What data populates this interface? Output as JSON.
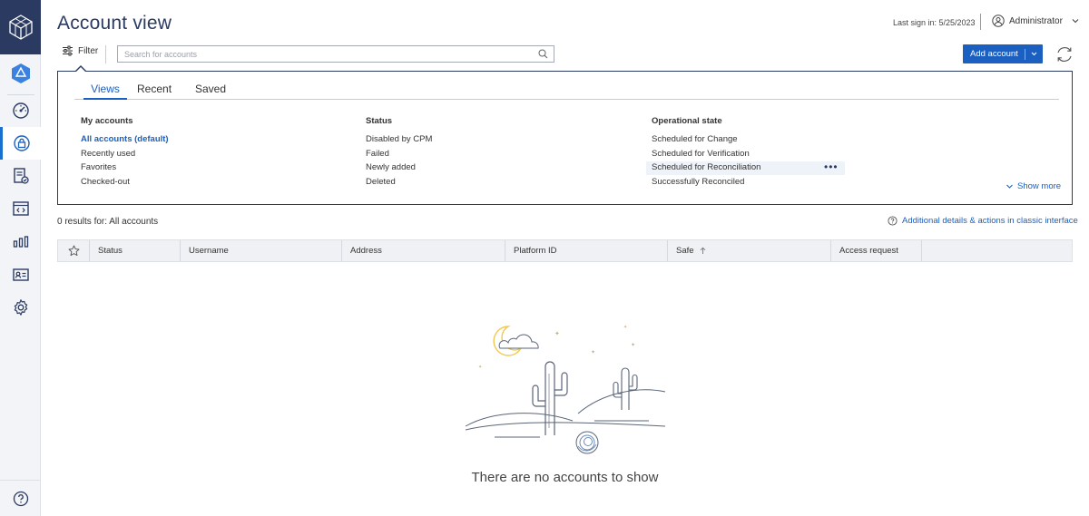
{
  "header": {
    "title": "Account view",
    "last_sign_in": "Last sign in: 5/25/2023",
    "user_name": "Administrator"
  },
  "toolbar": {
    "filter_label": "Filter",
    "search_placeholder": "Search for accounts",
    "add_account_label": "Add account"
  },
  "filter_panel": {
    "tabs": [
      {
        "label": "Views",
        "active": true
      },
      {
        "label": "Recent",
        "active": false
      },
      {
        "label": "Saved",
        "active": false
      }
    ],
    "columns": [
      {
        "heading": "My accounts",
        "items": [
          "All accounts (default)",
          "Recently used",
          "Favorites",
          "Checked-out"
        ],
        "selected": 0
      },
      {
        "heading": "Status",
        "items": [
          "Disabled by CPM",
          "Failed",
          "Newly added",
          "Deleted"
        ]
      },
      {
        "heading": "Operational state",
        "items": [
          "Scheduled for Change",
          "Scheduled for Verification",
          "Scheduled for Reconciliation",
          "Successfully Reconciled"
        ],
        "hovered": 2
      }
    ],
    "show_more": "Show more"
  },
  "results": {
    "count_text": "0 results  for: All accounts",
    "classic_link": "Additional details & actions in classic interface"
  },
  "table": {
    "columns": [
      "Status",
      "Username",
      "Address",
      "Platform ID",
      "Safe",
      "Access request"
    ],
    "sort_column": "Safe"
  },
  "empty_state": {
    "message": "There are no accounts to show"
  },
  "colors": {
    "brand_navy": "#2b3a61",
    "accent_blue": "#1b5fc1",
    "moon_yellow": "#f2c94c"
  }
}
